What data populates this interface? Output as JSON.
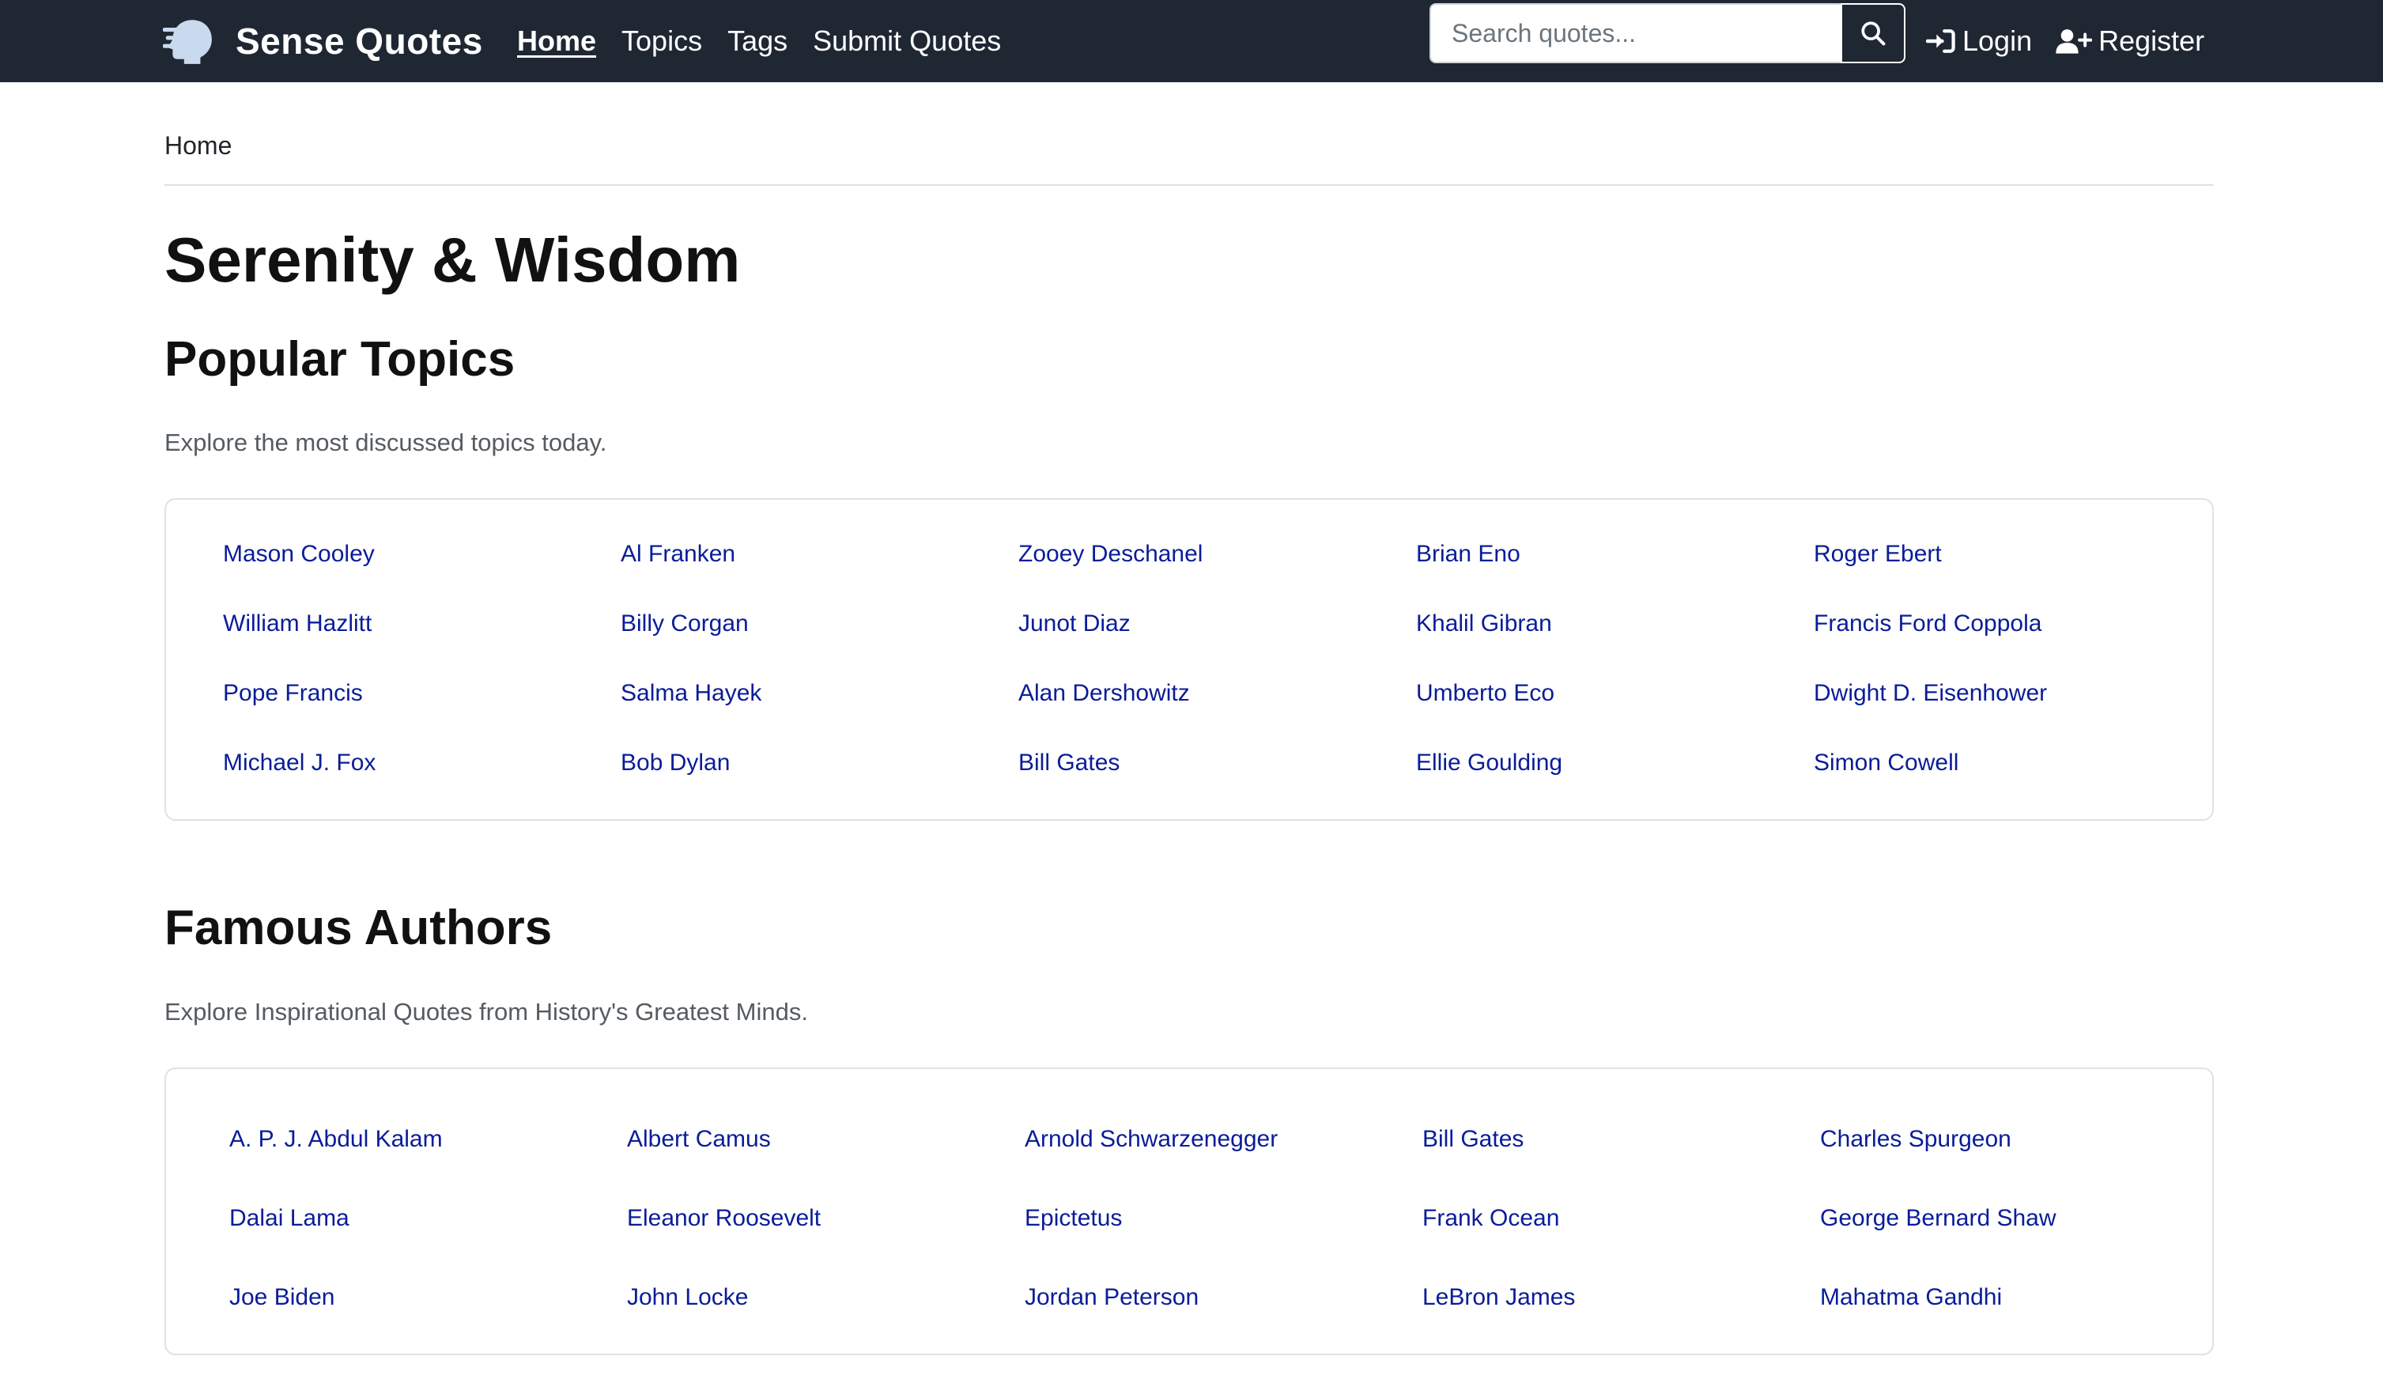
{
  "navbar": {
    "brand": "Sense Quotes",
    "links": [
      "Home",
      "Topics",
      "Tags",
      "Submit Quotes"
    ],
    "search_placeholder": "Search quotes...",
    "login": "Login",
    "register": "Register"
  },
  "breadcrumb": "Home",
  "site_title": "Serenity & Wisdom",
  "popular_topics": {
    "title": "Popular Topics",
    "description": "Explore the most discussed topics today.",
    "items": [
      "Mason Cooley",
      "Al Franken",
      "Zooey Deschanel",
      "Brian Eno",
      "Roger Ebert",
      "William Hazlitt",
      "Billy Corgan",
      "Junot Diaz",
      "Khalil Gibran",
      "Francis Ford Coppola",
      "Pope Francis",
      "Salma Hayek",
      "Alan Dershowitz",
      "Umberto Eco",
      "Dwight D. Eisenhower",
      "Michael J. Fox",
      "Bob Dylan",
      "Bill Gates",
      "Ellie Goulding",
      "Simon Cowell"
    ]
  },
  "famous_authors": {
    "title": "Famous Authors",
    "description": "Explore Inspirational Quotes from History's Greatest Minds.",
    "items": [
      "A. P. J. Abdul Kalam",
      "Albert Camus",
      "Arnold Schwarzenegger",
      "Bill Gates",
      "Charles Spurgeon",
      "Dalai Lama",
      "Eleanor Roosevelt",
      "Epictetus",
      "Frank Ocean",
      "George Bernard Shaw",
      "Joe Biden",
      "John Locke",
      "Jordan Peterson",
      "LeBron James",
      "Mahatma Gandhi"
    ]
  },
  "colors": {
    "navbar_bg": "#1f2733",
    "link": "#0a1c99"
  },
  "icons": {
    "brand": "head-wind-logo-icon",
    "search": "magnifier-icon",
    "login": "sign-in-icon",
    "register": "user-plus-icon"
  }
}
